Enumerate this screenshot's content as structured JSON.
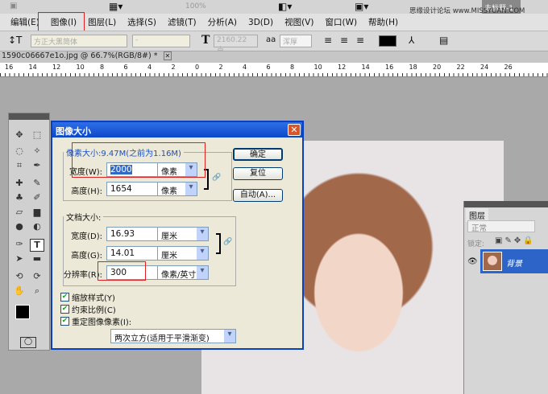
{
  "appbar": {
    "zoom": "100%",
    "doc_title": "未标题-1",
    "watermark": "思缘设计论坛 www.MISSYUAN.COM"
  },
  "menubar": {
    "items": [
      "编辑(E)",
      "图像(I)",
      "图层(L)",
      "选择(S)",
      "滤镜(T)",
      "分析(A)",
      "3D(D)",
      "视图(V)",
      "窗口(W)",
      "帮助(H)"
    ]
  },
  "options": {
    "font_family": "方正大黑简体",
    "font_style": "-",
    "font_size": "2160.22 点",
    "antialias": "浑厚",
    "color": "#000000"
  },
  "doc_tab": {
    "title": "1590c06667e1o.jpg @ 66.7%(RGB/8#) *"
  },
  "ruler": {
    "labels": [
      "16",
      "14",
      "12",
      "10",
      "8",
      "6",
      "4",
      "2",
      "0",
      "2",
      "4",
      "6",
      "8",
      "10",
      "12",
      "14",
      "16",
      "18",
      "20",
      "22",
      "24",
      "26"
    ]
  },
  "dialog": {
    "title": "图像大小",
    "pixel_size_label": "像素大小:9.47M(之前为1.16M)",
    "width_label": "宽度(W):",
    "width_value": "2000",
    "width_unit": "像素",
    "height_label": "高度(H):",
    "height_value": "1654",
    "height_unit": "像素",
    "doc_size_label": "文档大小:",
    "doc_width_label": "宽度(D):",
    "doc_width_value": "16.93",
    "doc_width_unit": "厘米",
    "doc_height_label": "高度(G):",
    "doc_height_value": "14.01",
    "doc_height_unit": "厘米",
    "resolution_label": "分辨率(R):",
    "resolution_value": "300",
    "resolution_unit": "像素/英寸",
    "ok": "确定",
    "reset": "复位",
    "auto": "自动(A)...",
    "scale_styles": "缩放样式(Y)",
    "constrain": "约束比例(C)",
    "resample": "重定图像像素(I):",
    "resample_method": "两次立方(适用于平滑渐变)"
  },
  "layers": {
    "tab": "图层",
    "blend_mode": "正常",
    "lock_label": "锁定:",
    "layer_name": "背景",
    "selected_color": "#2c64c8"
  }
}
